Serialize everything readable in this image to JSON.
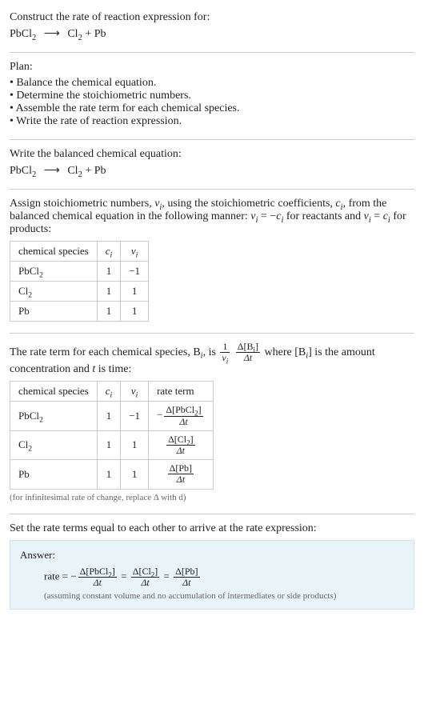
{
  "intro": {
    "prompt": "Construct the rate of reaction expression for:",
    "equation_reactant": "PbCl",
    "equation_reactant_sub": "2",
    "arrow": "⟶",
    "equation_product1": "Cl",
    "equation_product1_sub": "2",
    "plus": " + ",
    "equation_product2": "Pb"
  },
  "plan": {
    "heading": "Plan:",
    "items": [
      "• Balance the chemical equation.",
      "• Determine the stoichiometric numbers.",
      "• Assemble the rate term for each chemical species.",
      "• Write the rate of reaction expression."
    ]
  },
  "balanced": {
    "heading": "Write the balanced chemical equation:",
    "reactant": "PbCl",
    "reactant_sub": "2",
    "arrow": "⟶",
    "product1": "Cl",
    "product1_sub": "2",
    "plus": " + ",
    "product2": "Pb"
  },
  "stoich": {
    "text_part1": "Assign stoichiometric numbers, ",
    "nu_i": "ν",
    "nu_sub": "i",
    "text_part2": ", using the stoichiometric coefficients, ",
    "c_i": "c",
    "c_sub": "i",
    "text_part3": ", from the balanced chemical equation in the following manner: ",
    "relation1": "ν",
    "relation1_sub": "i",
    "relation1_eq": " = −",
    "relation1_rhs": "c",
    "relation1_rhs_sub": "i",
    "text_part4": " for reactants and ",
    "relation2": "ν",
    "relation2_sub": "i",
    "relation2_eq": " = ",
    "relation2_rhs": "c",
    "relation2_rhs_sub": "i",
    "text_part5": " for products:",
    "table": {
      "headers": {
        "species": "chemical species",
        "c": "c",
        "c_sub": "i",
        "nu": "ν",
        "nu_sub": "i"
      },
      "rows": [
        {
          "species": "PbCl",
          "species_sub": "2",
          "c": "1",
          "nu": "−1"
        },
        {
          "species": "Cl",
          "species_sub": "2",
          "c": "1",
          "nu": "1"
        },
        {
          "species": "Pb",
          "species_sub": "",
          "c": "1",
          "nu": "1"
        }
      ]
    }
  },
  "rateterm": {
    "text_part1": "The rate term for each chemical species, B",
    "b_sub": "i",
    "text_part2": ", is ",
    "frac1_num": "1",
    "frac1_den_nu": "ν",
    "frac1_den_sub": "i",
    "frac2_num": "Δ[B",
    "frac2_num_sub": "i",
    "frac2_num_close": "]",
    "frac2_den": "Δt",
    "text_part3": " where [B",
    "text_part3_sub": "i",
    "text_part4": "] is the amount concentration and ",
    "t_var": "t",
    "text_part5": " is time:",
    "table": {
      "headers": {
        "species": "chemical species",
        "c": "c",
        "c_sub": "i",
        "nu": "ν",
        "nu_sub": "i",
        "rate": "rate term"
      },
      "rows": [
        {
          "species": "PbCl",
          "species_sub": "2",
          "c": "1",
          "nu": "−1",
          "rate_neg": "−",
          "rate_num": "Δ[PbCl",
          "rate_num_sub": "2",
          "rate_num_close": "]",
          "rate_den": "Δt"
        },
        {
          "species": "Cl",
          "species_sub": "2",
          "c": "1",
          "nu": "1",
          "rate_neg": "",
          "rate_num": "Δ[Cl",
          "rate_num_sub": "2",
          "rate_num_close": "]",
          "rate_den": "Δt"
        },
        {
          "species": "Pb",
          "species_sub": "",
          "c": "1",
          "nu": "1",
          "rate_neg": "",
          "rate_num": "Δ[Pb]",
          "rate_num_sub": "",
          "rate_num_close": "",
          "rate_den": "Δt"
        }
      ]
    },
    "note": "(for infinitesimal rate of change, replace Δ with d)"
  },
  "final": {
    "heading": "Set the rate terms equal to each other to arrive at the rate expression:",
    "answer_label": "Answer:",
    "rate_prefix": "rate = −",
    "term1_num": "Δ[PbCl",
    "term1_num_sub": "2",
    "term1_num_close": "]",
    "term1_den": "Δt",
    "eq": " = ",
    "term2_num": "Δ[Cl",
    "term2_num_sub": "2",
    "term2_num_close": "]",
    "term2_den": "Δt",
    "term3_num": "Δ[Pb]",
    "term3_den": "Δt",
    "note": "(assuming constant volume and no accumulation of intermediates or side products)"
  }
}
